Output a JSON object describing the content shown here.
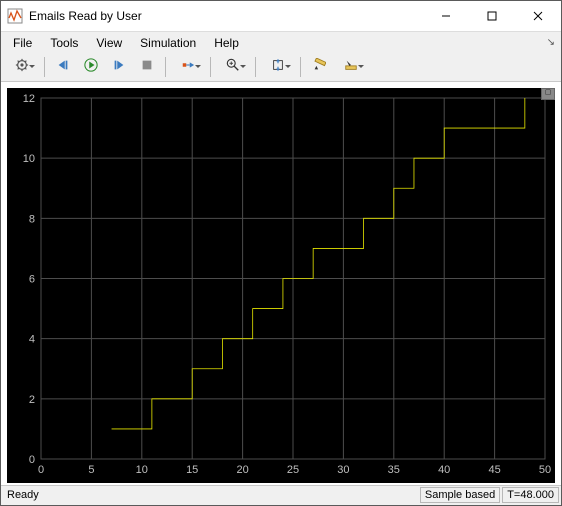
{
  "window": {
    "title": "Emails Read by User"
  },
  "menubar": {
    "items": [
      "File",
      "Tools",
      "View",
      "Simulation",
      "Help"
    ]
  },
  "toolbar": {
    "buttons": [
      {
        "name": "config-dropdown",
        "icon": "gear",
        "dd": true
      },
      {
        "sep": true
      },
      {
        "name": "step-back",
        "icon": "step-back"
      },
      {
        "name": "run",
        "icon": "play"
      },
      {
        "name": "step-forward",
        "icon": "step-fwd"
      },
      {
        "name": "stop",
        "icon": "stop"
      },
      {
        "sep": true
      },
      {
        "name": "highlight-signal",
        "icon": "signal",
        "dd": true
      },
      {
        "sep": true
      },
      {
        "name": "zoom-dropdown",
        "icon": "zoom",
        "dd": true
      },
      {
        "sep": true
      },
      {
        "name": "autoscale-dropdown",
        "icon": "autoscale",
        "dd": true
      },
      {
        "sep": true
      },
      {
        "name": "measure",
        "icon": "ruler"
      },
      {
        "name": "annotate-dropdown",
        "icon": "annotate",
        "dd": true
      }
    ]
  },
  "statusbar": {
    "ready": "Ready",
    "mode": "Sample based",
    "time": "T=48.000"
  },
  "chart_data": {
    "type": "line",
    "series": [
      {
        "name": "emails",
        "step": "post",
        "x": [
          7,
          11,
          15,
          18,
          21,
          24,
          27,
          32,
          35,
          37,
          40,
          48,
          48
        ],
        "y": [
          1,
          2,
          3,
          4,
          5,
          6,
          7,
          8,
          9,
          10,
          11,
          11,
          12
        ]
      }
    ],
    "xlim": [
      0,
      50
    ],
    "ylim": [
      0,
      12
    ],
    "xticks": [
      0,
      5,
      10,
      15,
      20,
      25,
      30,
      35,
      40,
      45,
      50
    ],
    "yticks": [
      0,
      2,
      4,
      6,
      8,
      10,
      12
    ],
    "xlabel": "",
    "ylabel": "",
    "title": ""
  }
}
